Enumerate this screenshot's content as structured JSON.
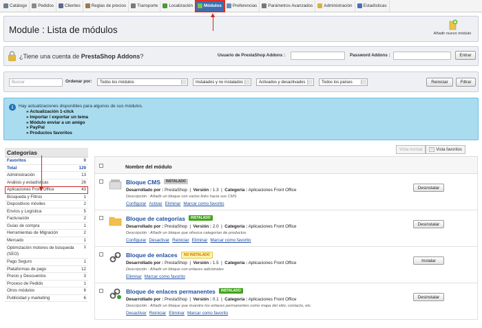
{
  "nav": [
    {
      "label": "Catálogo",
      "icon": "catalog-icon",
      "color": "#6b7c93"
    },
    {
      "label": "Pedidos",
      "icon": "orders-icon",
      "color": "#8a8a8a"
    },
    {
      "label": "Clientes",
      "icon": "customers-icon",
      "color": "#5b6b8c"
    },
    {
      "label": "Reglas de precios",
      "icon": "price-rules-icon",
      "color": "#9a7b50"
    },
    {
      "label": "Transporte",
      "icon": "truck-icon",
      "color": "#7a7a7a"
    },
    {
      "label": "Localización",
      "icon": "localization-icon",
      "color": "#4a9a3c"
    },
    {
      "label": "Módulos",
      "icon": "puzzle-icon",
      "color": "#79c542",
      "active": true
    },
    {
      "label": "Preferencias",
      "icon": "preferences-icon",
      "color": "#6b8fb0"
    },
    {
      "label": "Parámetros Avanzados",
      "icon": "wrench-icon",
      "color": "#777"
    },
    {
      "label": "Administración",
      "icon": "key-icon",
      "color": "#d8b23c"
    },
    {
      "label": "Estadísticas",
      "icon": "stats-icon",
      "color": "#4a6fb8"
    }
  ],
  "header": {
    "title": "Module : Lista de módulos",
    "add_label": "Añadir nuevo módulo"
  },
  "addons": {
    "question_prefix": "¿Tiene una cuenta de ",
    "question_brand": "PrestaShop Addons",
    "question_suffix": "?",
    "user_label": "Usuario de PrestaShop Addons :",
    "pass_label": "Password Addons :",
    "enter_label": "Entrar"
  },
  "filter": {
    "search_placeholder": "Buscar",
    "order_label": "Ordenar por:",
    "select_modules": "Todos los módulos",
    "select_installed": "Instalados y no instalados",
    "select_activated": "Activados y desactivados",
    "select_countries": "Todos los países",
    "reset_label": "Reiniciar",
    "filter_label": "Filtrar"
  },
  "info": {
    "text": "Hay actualizaciones disponibles para algunos de sus módulos.",
    "items": [
      "Actualización 1-click",
      "Importar / exportar un tema",
      "Módulo enviar a un amigo",
      "PayPal",
      "Productos favoritos"
    ]
  },
  "sidebar": {
    "title": "Categorías",
    "items": [
      {
        "label": "Favoritos",
        "count": "0"
      },
      {
        "label": "Total",
        "count": "129"
      },
      {
        "label": "Administración",
        "count": "13"
      },
      {
        "label": "Análisis y estadísticas",
        "count": "26"
      },
      {
        "label": "Aplicaciones Front Office",
        "count": "43"
      },
      {
        "label": "Búsqueda y Filtros",
        "count": "1"
      },
      {
        "label": "Dispositivos móviles",
        "count": "2"
      },
      {
        "label": "Envíos y Logística",
        "count": "5"
      },
      {
        "label": "Facturación",
        "count": "2"
      },
      {
        "label": "Guías de compra",
        "count": "1"
      },
      {
        "label": "Herramientas de Migración",
        "count": "2"
      },
      {
        "label": "Mercado",
        "count": "1"
      },
      {
        "label": "Optimización motores de búsqueda (SEO)",
        "count": "1"
      },
      {
        "label": "Pago Seguro",
        "count": "1"
      },
      {
        "label": "Plataformas de pago",
        "count": "12"
      },
      {
        "label": "Precio y Descuentos",
        "count": "3"
      },
      {
        "label": "Proceso de Pedido",
        "count": "1"
      },
      {
        "label": "Otros módulos",
        "count": "6"
      },
      {
        "label": "Publicidad y marketing",
        "count": "6"
      }
    ]
  },
  "view": {
    "normal_label": "Vista normal",
    "favorites_label": "Vista favoritos"
  },
  "modules": {
    "column_title": "Nombre del módulo",
    "dev_label": "Desarrollado por :",
    "version_label": "Versión :",
    "category_label": "Categoría :",
    "list": [
      {
        "name": "Bloque CMS",
        "badge": "INSTALADO",
        "badge_type": "gray",
        "icon": "cms-block-icon",
        "dev": "PrestaShop",
        "version": "1.3",
        "category": "Aplicaciones Front Office",
        "desc": "Descripción : Añadir un bloque con varios links hacia sus CMS",
        "actions": [
          "Configurar",
          "Activar",
          "Eliminar",
          "Marcar como favorito"
        ],
        "button": "Desinstalar"
      },
      {
        "name": "Bloque de categorías",
        "badge": "INSTALADO",
        "badge_type": "ok",
        "icon": "folder-icon",
        "dev": "PrestaShop",
        "version": "2.0",
        "category": "Aplicaciones Front Office",
        "desc": "Descripción : Añadir un bloque que ofrezca categorías de productos",
        "actions": [
          "Configurar",
          "Desactivar",
          "Reiniciar",
          "Eliminar",
          "Marcar como favorito"
        ],
        "button": "Desinstalar"
      },
      {
        "name": "Bloque de enlaces",
        "badge": "NO INSTALADO",
        "badge_type": "no",
        "icon": "link-icon",
        "dev": "PrestaShop",
        "version": "1.5",
        "category": "Aplicaciones Front Office",
        "desc": "Descripción : Añadir un bloque con enlaces adicionales",
        "actions": [
          "Eliminar",
          "Marcar como favorito"
        ],
        "button": "Instalar"
      },
      {
        "name": "Bloque de enlaces permanentes",
        "badge": "INSTALADO",
        "badge_type": "ok",
        "icon": "permalink-icon",
        "dev": "PrestaShop",
        "version": "0.1",
        "category": "Aplicaciones Front Office",
        "desc": "Descripción : Añadir un bloque que muestre los enlaces permanentes como mapa del sitio, contacto, etc.",
        "actions": [
          "Desactivar",
          "Reiniciar",
          "Eliminar",
          "Marcar como favorito"
        ],
        "button": "Desinstalar"
      }
    ]
  }
}
